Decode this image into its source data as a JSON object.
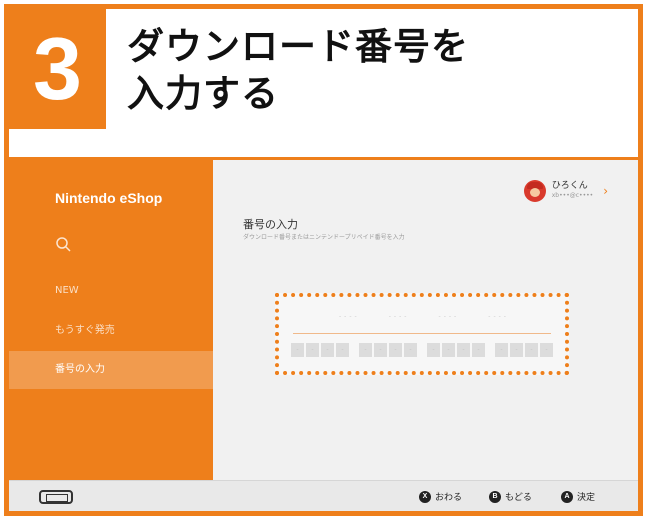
{
  "header": {
    "step_number": "3",
    "title_line1": "ダウンロード番号を",
    "title_line2": "入力する"
  },
  "sidebar": {
    "logo": "Nintendo eShop",
    "search_icon": "search-icon",
    "items": [
      {
        "label": "NEW"
      },
      {
        "label": "もうすぐ発売"
      },
      {
        "label": "番号の入力"
      }
    ]
  },
  "user": {
    "name": "ひろくん",
    "id": "xb•••@c••••",
    "chevron": "›"
  },
  "page": {
    "title": "番号の入力",
    "subtitle": "ダウンロード番号またはニンテンドープリペイド番号を入力"
  },
  "code_entry": {
    "dash_groups": [
      "----",
      "----",
      "----",
      "----"
    ],
    "key_groups": [
      [
        "-",
        "-",
        "-",
        "-"
      ],
      [
        "-",
        "-",
        "-",
        "-"
      ],
      [
        "-",
        "-",
        "-",
        "-"
      ],
      [
        "-",
        "-",
        "-",
        "-"
      ]
    ]
  },
  "bottombar": {
    "console_icon": "switch-console-icon",
    "hints": [
      {
        "button": "X",
        "label": "おわる"
      },
      {
        "button": "B",
        "label": "もどる"
      },
      {
        "button": "A",
        "label": "決定"
      }
    ]
  },
  "colors": {
    "accent": "#ee7f1b",
    "sidebar_active": "#f19b4e",
    "screen_bg": "#f1f1f1"
  }
}
